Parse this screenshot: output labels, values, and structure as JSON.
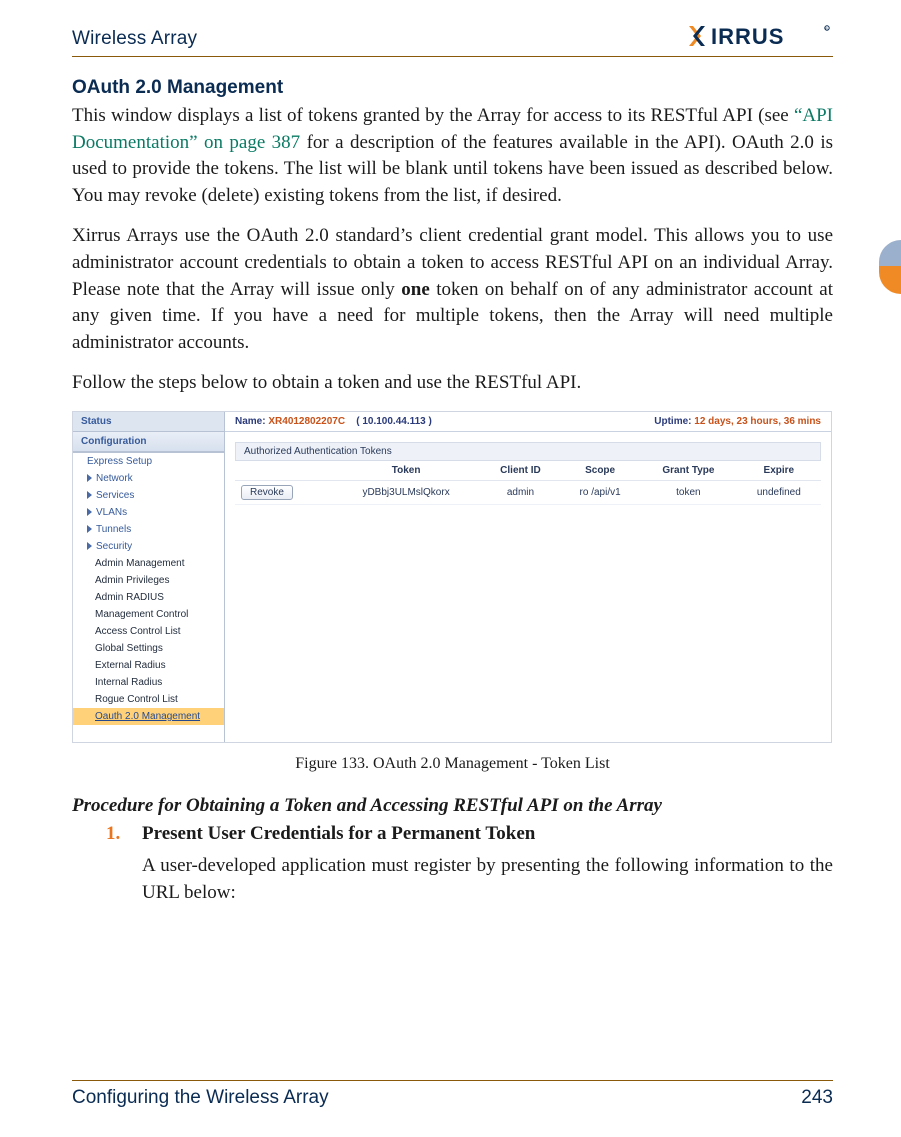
{
  "header": {
    "title": "Wireless Array",
    "brand_name": "XIRRUS"
  },
  "section_title": "OAuth 2.0 Management",
  "para1": {
    "a": "This window displays a list of tokens granted by the Array for access to its RESTful API (see ",
    "link": "“API Documentation” on page 387",
    "b": " for a description of the features available in the API). OAuth 2.0 is used to provide the tokens. The list will be blank until tokens have been issued as described below. You may revoke (delete) existing tokens from the list, if desired."
  },
  "para2": {
    "a": "Xirrus Arrays use the OAuth 2.0 standard’s client credential grant model. This allows you to use administrator account credentials to obtain a token to access RESTful API on an individual Array. Please note that the Array will issue only ",
    "bold": "one",
    "b": " token on behalf on of any administrator account at any given time. If you have a need for multiple tokens, then the Array will need multiple administrator accounts."
  },
  "para3": "Follow the steps below to obtain a token and use the RESTful API.",
  "shot": {
    "sidebar": {
      "status": "Status",
      "config": "Configuration",
      "items": [
        {
          "label": "Express Setup",
          "tri": false
        },
        {
          "label": "Network",
          "tri": true
        },
        {
          "label": "Services",
          "tri": true
        },
        {
          "label": "VLANs",
          "tri": true
        },
        {
          "label": "Tunnels",
          "tri": true
        },
        {
          "label": "Security",
          "tri": true
        }
      ],
      "sub": [
        "Admin Management",
        "Admin Privileges",
        "Admin RADIUS",
        "Management Control",
        "Access Control List",
        "Global Settings",
        "External Radius",
        "Internal Radius",
        "Rogue Control List",
        "Oauth 2.0 Management"
      ]
    },
    "top": {
      "name_k": "Name:",
      "name_v": "XR4012802207C",
      "ip": "( 10.100.44.113 )",
      "uptime_k": "Uptime:",
      "uptime_v": "12 days, 23 hours, 36 mins"
    },
    "panel_title": "Authorized Authentication Tokens",
    "columns": [
      "Token",
      "Client ID",
      "Scope",
      "Grant Type",
      "Expire"
    ],
    "row": {
      "revoke": "Revoke",
      "token": "yDBbj3ULMslQkorx",
      "client": "admin",
      "scope": "ro /api/v1",
      "grant": "token",
      "expire": "undefined"
    }
  },
  "caption": "Figure 133. OAuth 2.0 Management - Token List",
  "procedure_title": "Procedure for Obtaining a Token and Accessing RESTful API on the Array",
  "step": {
    "num": "1.",
    "title": "Present User Credentials for a Permanent Token",
    "body": "A user-developed application must register by presenting the following information to the URL below:"
  },
  "footer": {
    "left": "Configuring the Wireless Array",
    "right": "243"
  }
}
